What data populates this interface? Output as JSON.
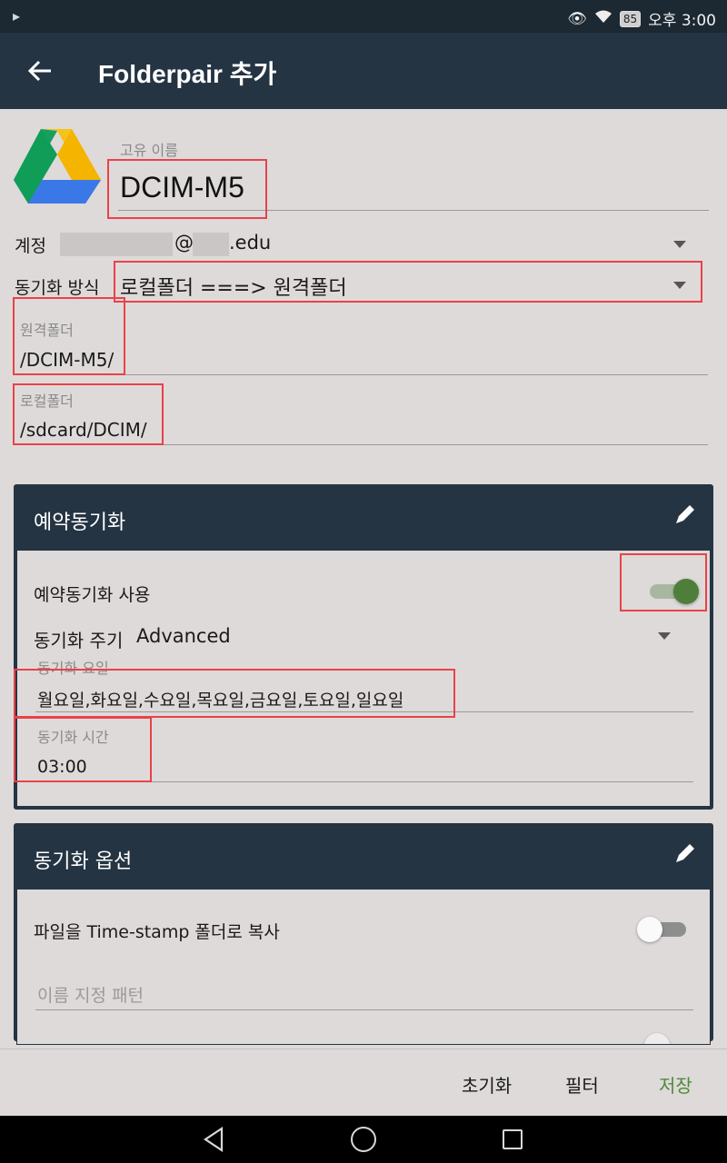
{
  "status_bar": {
    "time": "오후 3:00",
    "battery": "85"
  },
  "app_bar": {
    "title": "Folderpair 추가"
  },
  "form": {
    "name_label": "고유 이름",
    "name_value": "DCIM-M5",
    "account_label": "계정",
    "account_at": "@",
    "account_domain": ".edu",
    "sync_method_label": "동기화 방식",
    "sync_method_value": "로컬폴더 ===> 원격폴더",
    "remote_label": "원격폴더",
    "remote_value": "/DCIM-M5/",
    "local_label": "로컬폴더",
    "local_value": "/sdcard/DCIM/"
  },
  "schedule_card": {
    "title": "예약동기화",
    "use_label": "예약동기화 사용",
    "use_enabled": true,
    "cycle_label": "동기화 주기",
    "cycle_value": "Advanced",
    "days_label": "동기화 요일",
    "days_value": "월요일,화요일,수요일,목요일,금요일,토요일,일요일",
    "time_label": "동기화 시간",
    "time_value": "03:00"
  },
  "options_card": {
    "title": "동기화 옵션",
    "timestamp_label": "파일을 Time-stamp 폴더로 복사",
    "timestamp_enabled": false,
    "pattern_placeholder": "이름 지정 패턴"
  },
  "actions": {
    "reset": "초기화",
    "filter": "필터",
    "save": "저장"
  },
  "colors": {
    "app_bar": "#243443",
    "accent_green": "#4e8a3a",
    "highlight_red": "#e8424a"
  }
}
